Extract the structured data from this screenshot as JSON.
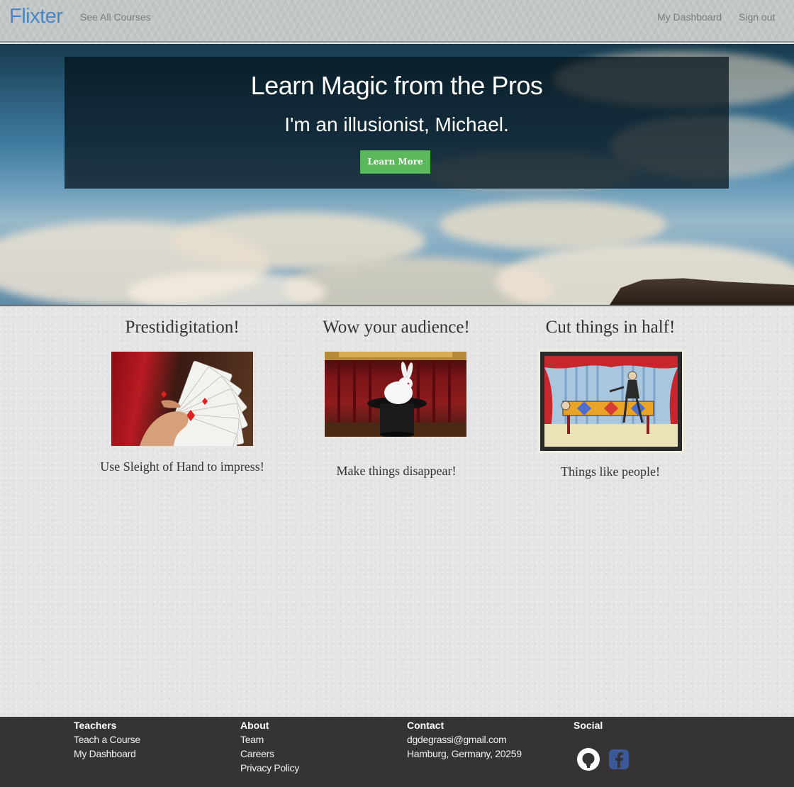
{
  "navbar": {
    "brand": "Flixter",
    "see_all_courses": "See All Courses",
    "my_dashboard": "My Dashboard",
    "sign_out": "Sign out"
  },
  "hero": {
    "title": "Learn Magic from the Pros",
    "subtitle": "I'm an illusionist, Michael.",
    "button_label": "Learn More"
  },
  "features": [
    {
      "heading": "Prestidigitation!",
      "caption": "Use Sleight of Hand to impress!",
      "image_icon": "playing-cards-image"
    },
    {
      "heading": "Wow your audience!",
      "caption": "Make things disappear!",
      "image_icon": "rabbit-in-hat-image"
    },
    {
      "heading": "Cut things in half!",
      "caption": "Things like people!",
      "image_icon": "saw-in-half-illustration"
    }
  ],
  "footer": {
    "teachers": {
      "heading": "Teachers",
      "links": [
        "Teach a Course",
        "My Dashboard"
      ]
    },
    "about": {
      "heading": "About",
      "links": [
        "Team",
        "Careers",
        "Privacy Policy"
      ]
    },
    "contact": {
      "heading": "Contact",
      "lines": [
        "dgdegrassi@gmail.com",
        "Hamburg, Germany, 20259"
      ]
    },
    "social": {
      "heading": "Social",
      "icons": [
        "github-icon",
        "facebook-icon"
      ]
    }
  },
  "colors": {
    "brand": "#4a86c5",
    "button": "#5cb85c",
    "footer_bg": "#353333",
    "facebook": "#3b5998"
  }
}
